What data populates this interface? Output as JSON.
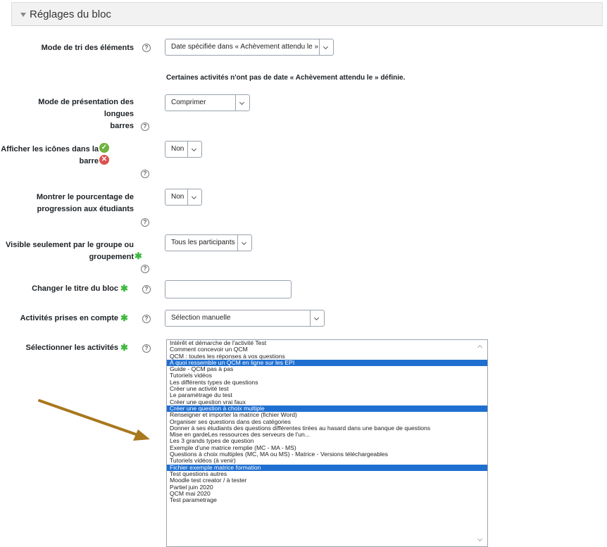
{
  "header": {
    "title": "Réglages du bloc"
  },
  "fields": {
    "sort": {
      "label": "Mode de tri des éléments",
      "value": "Date spécifiée dans « Achèvement attendu le »"
    },
    "note": "Certaines activités n'ont pas de date « Achèvement attendu le » définie.",
    "longbars": {
      "label_line1": "Mode de présentation des longues",
      "label_line2": "barres",
      "value": "Comprimer"
    },
    "icons": {
      "label": "Afficher les icônes dans la barre",
      "value": "Non"
    },
    "percent": {
      "label_line1": "Montrer le pourcentage de",
      "label_line2": "progression aux étudiants",
      "value": "Non"
    },
    "group": {
      "label_line1": "Visible seulement par le groupe ou",
      "label_line2": "groupement",
      "value": "Tous les participants"
    },
    "title": {
      "label": "Changer le titre du bloc",
      "value": ""
    },
    "activities": {
      "label": "Activités prises en compte",
      "value": "Sélection manuelle"
    },
    "select": {
      "label": "Sélectionner les activités"
    }
  },
  "icons": {
    "help": "?",
    "check": "✓",
    "cross": "✕",
    "required": "✱"
  },
  "activity_list": [
    {
      "text": "Intérêt et démarche de l'activité Test",
      "selected": false
    },
    {
      "text": "Comment concevoir un QCM",
      "selected": false
    },
    {
      "text": "QCM : toutes les réponses à vos questions",
      "selected": false
    },
    {
      "text": "À quoi ressemble un QCM en ligne sur les EPI",
      "selected": true
    },
    {
      "text": "Guide - QCM pas à pas",
      "selected": false
    },
    {
      "text": "Tutoriels vidéos",
      "selected": false
    },
    {
      "text": "Les différents types de questions",
      "selected": false
    },
    {
      "text": "Créer une activité test",
      "selected": false
    },
    {
      "text": "Le paramétrage du test",
      "selected": false
    },
    {
      "text": "Créer une question vrai faux",
      "selected": false
    },
    {
      "text": "Créer une question à choix multiple",
      "selected": true
    },
    {
      "text": "Renseigner et importer la matrice (fichier Word)",
      "selected": false
    },
    {
      "text": "Organiser ses questions dans des catégories",
      "selected": false
    },
    {
      "text": "Donner à ses étudiants des questions différentes tirées au hasard dans une banque de questions",
      "selected": false
    },
    {
      "text": "Mise en gardeLes ressources des serveurs de l'un...",
      "selected": false
    },
    {
      "text": "Les 3 grands types de question",
      "selected": false
    },
    {
      "text": "Exemple d'une matrice remplie (MC - MA - MS)",
      "selected": false
    },
    {
      "text": "Questions à choix multiples (MC, MA ou MS) - Matrice - Versions téléchargeables",
      "selected": false
    },
    {
      "text": "Tutoriels vidéos (à venir)",
      "selected": false
    },
    {
      "text": "Fichier exemple matrice formation",
      "selected": true
    },
    {
      "text": "Test questions autres",
      "selected": false
    },
    {
      "text": "Moodle test creator / à tester",
      "selected": false
    },
    {
      "text": "Partiel juin 2020",
      "selected": false
    },
    {
      "text": "QCM mai 2020",
      "selected": false
    },
    {
      "text": "Test parametrage",
      "selected": false
    }
  ],
  "colors": {
    "accent": "#1f6fd1",
    "required": "#3db83d",
    "annotation_arrow": "#a8781e"
  }
}
